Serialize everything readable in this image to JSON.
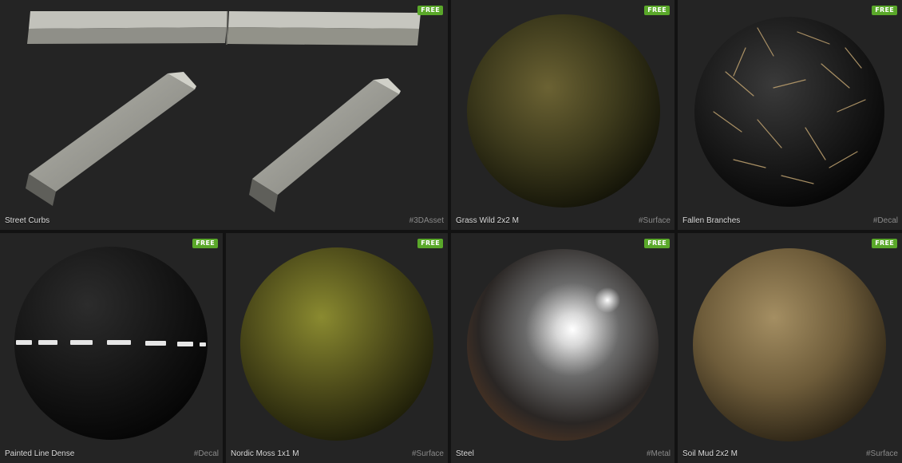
{
  "badge_label": "FREE",
  "assets": [
    {
      "name": "Street Curbs",
      "tag": "#3DAsset",
      "free": true
    },
    {
      "name": "Grass Wild 2x2 M",
      "tag": "#Surface",
      "free": true
    },
    {
      "name": "Fallen Branches",
      "tag": "#Decal",
      "free": true
    },
    {
      "name": "Painted Line Dense",
      "tag": "#Decal",
      "free": true
    },
    {
      "name": "Nordic Moss 1x1 M",
      "tag": "#Surface",
      "free": true
    },
    {
      "name": "Steel",
      "tag": "#Metal",
      "free": true
    },
    {
      "name": "Soil Mud 2x2 M",
      "tag": "#Surface",
      "free": true
    }
  ],
  "colors": {
    "badge": "#5aa82a",
    "card_bg": "#242424",
    "page_bg": "#121212"
  }
}
